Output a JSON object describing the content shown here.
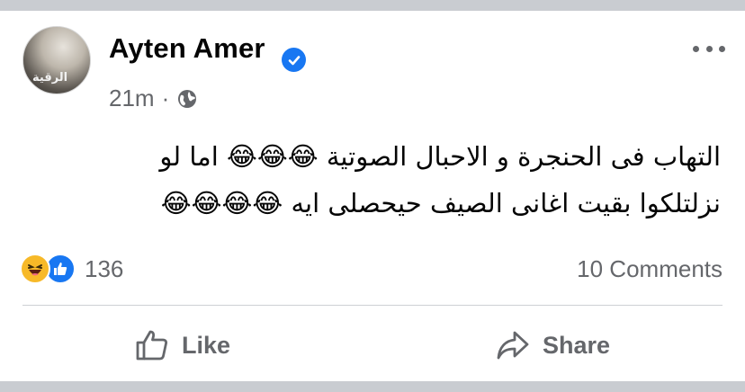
{
  "post": {
    "author": "Ayten Amer",
    "time": "21m",
    "separator": "·",
    "text_line1": "التهاب فى الحنجرة و الاحبال الصوتية 😂😂😂 اما لو",
    "text_line2": "نزلتلكوا بقيت اغانى الصيف حيحصلى ايه 😂😂😂😂",
    "reaction_count": "136",
    "comments_label": "10 Comments",
    "avatar_caption": "الرقية"
  },
  "actions": {
    "like_label": "Like",
    "share_label": "Share"
  },
  "icons": {
    "verified": "verified-badge-icon",
    "privacy": "globe-icon",
    "more": "more-options-icon",
    "reaction_1": "haha-reaction-icon",
    "reaction_2": "like-reaction-icon",
    "like": "thumbs-up-icon",
    "share": "share-arrow-icon"
  },
  "colors": {
    "brand": "#1877f2",
    "secondary_text": "#65676b",
    "primary_text": "#050505",
    "haha": "#f7b928"
  }
}
